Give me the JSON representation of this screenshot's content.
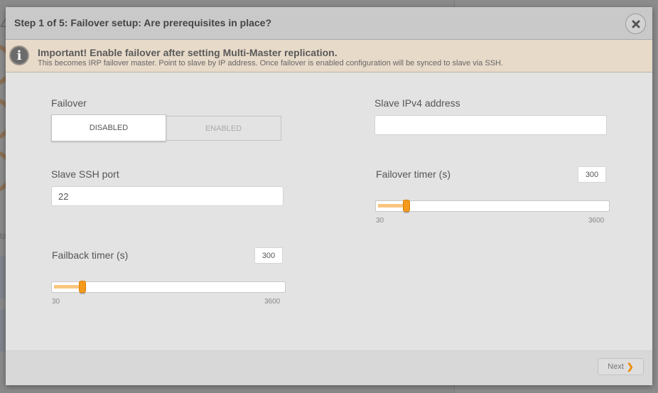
{
  "modal": {
    "title": "Step 1 of 5: Failover setup: Are prerequisites in place?",
    "close_icon": "close-icon"
  },
  "alert": {
    "icon": "info-icon",
    "icon_glyph": "i",
    "title": "Important! Enable failover after setting Multi-Master replication.",
    "text": "This becomes IRP failover master. Point to slave by IP address. Once failover is enabled configuration will be synced to slave via SSH."
  },
  "form": {
    "failover": {
      "label": "Failover",
      "options": [
        "DISABLED",
        "ENABLED"
      ],
      "selected": "DISABLED"
    },
    "slave_ipv4": {
      "label": "Slave IPv4 address",
      "value": "",
      "placeholder": ""
    },
    "slave_ssh_port": {
      "label": "Slave SSH port",
      "value": "22"
    },
    "failover_timer": {
      "label": "Failover timer (s)",
      "value": "300",
      "min": "30",
      "max": "3600",
      "fraction": 0.076
    },
    "failback_timer": {
      "label": "Failback timer (s)",
      "value": "300",
      "min": "30",
      "max": "3600",
      "fraction": 0.076
    }
  },
  "footer": {
    "next_label": "Next",
    "next_icon": "chevron-right-icon",
    "next_glyph": "❯"
  },
  "background": {
    "partial_text": "ta"
  },
  "colors": {
    "accent": "#f49a1c",
    "alert_bg": "#e8dac9"
  }
}
